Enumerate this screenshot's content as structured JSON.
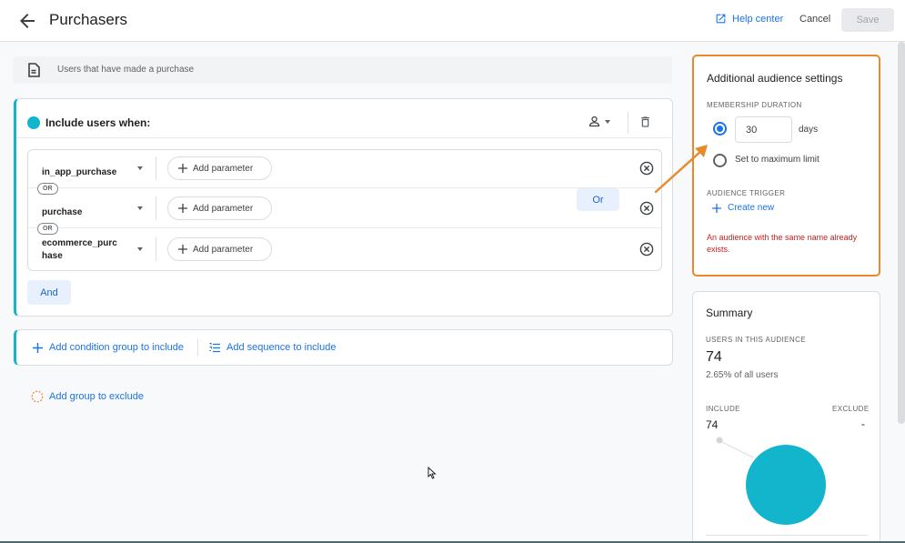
{
  "header": {
    "title": "Purchasers",
    "help_center": "Help center",
    "cancel": "Cancel",
    "save": "Save"
  },
  "description": "Users that have made a purchase",
  "include_group": {
    "title": "Include users when:",
    "conditions": [
      {
        "event": "in_app_purchase",
        "add_param": "Add parameter"
      },
      {
        "event": "purchase",
        "add_param": "Add parameter"
      },
      {
        "event_line1": "ecommerce_purc",
        "event_line2": "hase",
        "add_param": "Add parameter"
      }
    ],
    "or_chip": "OR",
    "or_button": "Or",
    "and_button": "And"
  },
  "actions": {
    "add_condition_group": "Add condition group to include",
    "add_sequence": "Add sequence to include",
    "add_exclude": "Add group to exclude"
  },
  "settings": {
    "title": "Additional audience settings",
    "membership_label": "MEMBERSHIP DURATION",
    "days_value": "30",
    "days_unit": "days",
    "max_limit": "Set to maximum limit",
    "trigger_label": "AUDIENCE TRIGGER",
    "create_new": "Create new",
    "error": "An audience with the same name already exists."
  },
  "summary": {
    "title": "Summary",
    "users_label": "USERS IN THIS AUDIENCE",
    "users_count": "74",
    "users_pct": "2.65% of all users",
    "include_label": "INCLUDE",
    "exclude_label": "EXCLUDE",
    "include_value": "74",
    "exclude_value": "-"
  },
  "colors": {
    "accent": "#1a73e8",
    "teal": "#12b5cb",
    "highlight": "#e8892e",
    "error": "#c5221f"
  }
}
